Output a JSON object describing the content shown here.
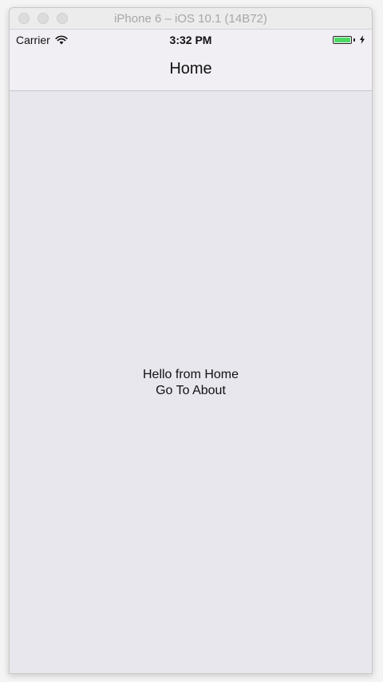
{
  "window": {
    "title": "iPhone 6 – iOS 10.1 (14B72)"
  },
  "status_bar": {
    "carrier": "Carrier",
    "time": "3:32 PM",
    "wifi_icon": "wifi-icon",
    "battery_icon": "battery-icon",
    "charging_icon": "bolt-icon",
    "battery_level": 1.0,
    "battery_color": "#4cd964"
  },
  "nav": {
    "title": "Home"
  },
  "content": {
    "greeting": "Hello from Home",
    "link_label": "Go To About"
  }
}
